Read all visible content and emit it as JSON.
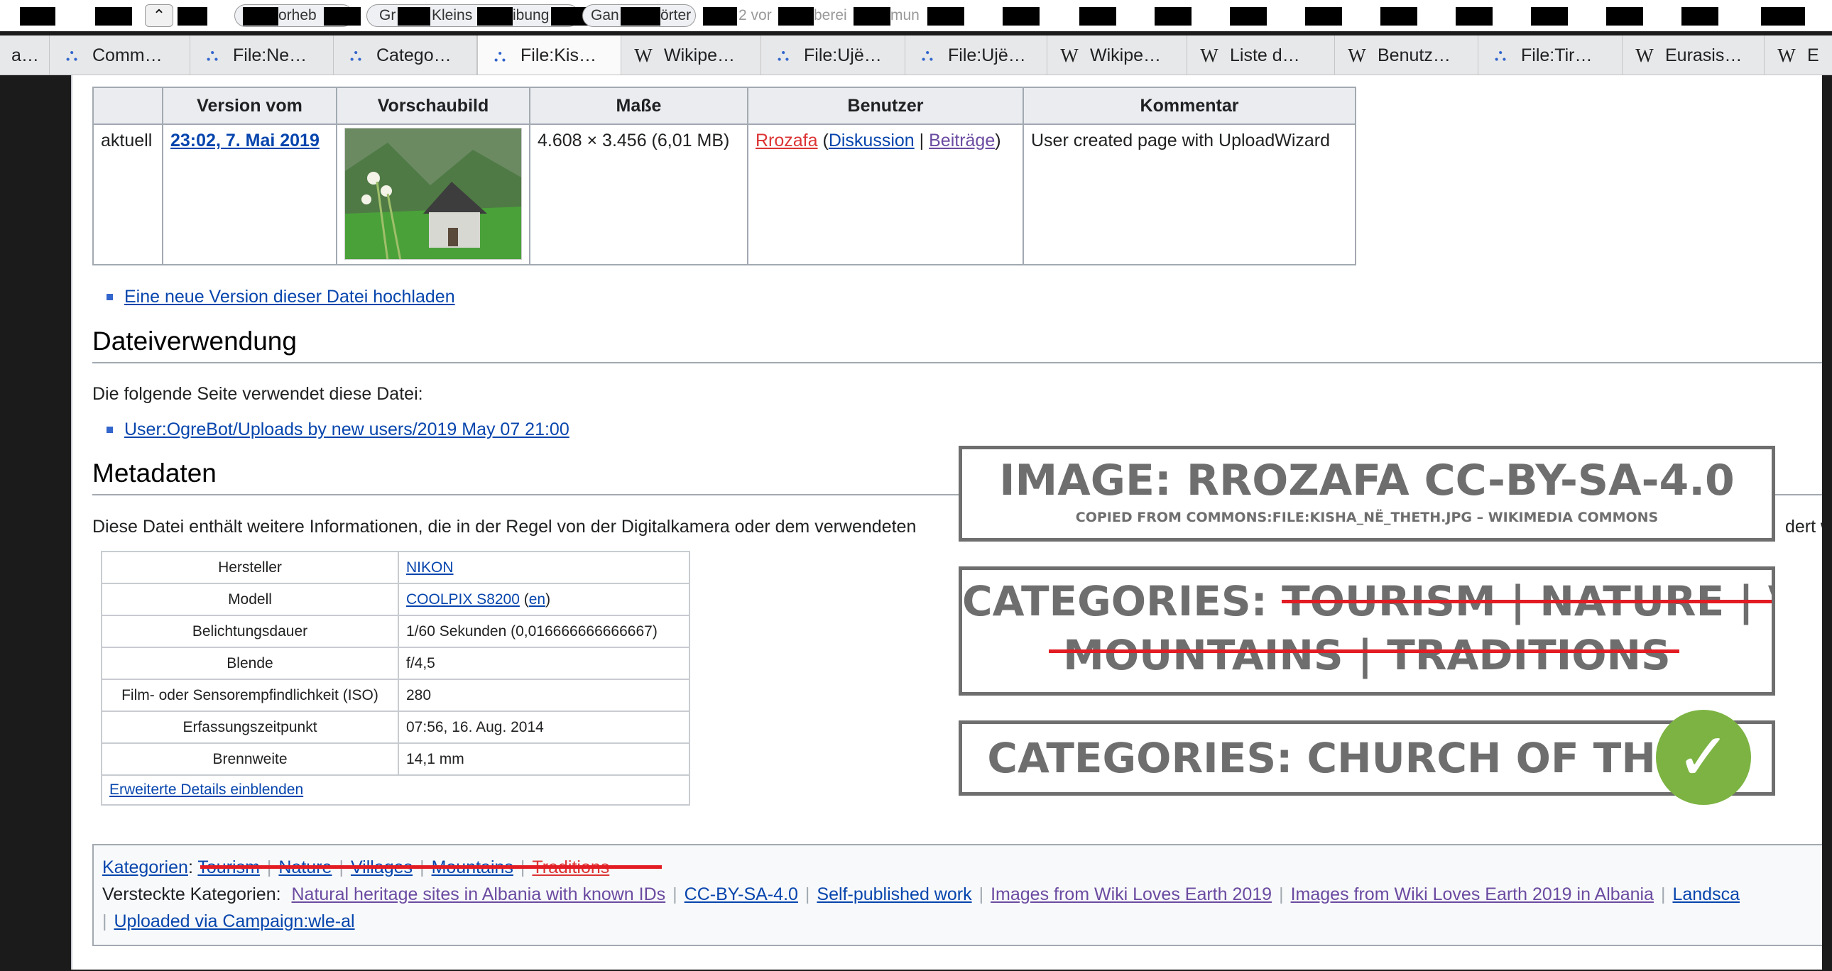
{
  "findbar": {
    "highlight": "orheb",
    "case": "Gr",
    "case2": "Kleins",
    "case3": "ibung",
    "words": "Gan",
    "words2": "örter",
    "matches": "2 vor",
    "matches2": "berei",
    "matches3": "mun"
  },
  "tabs": [
    {
      "icon": "commons",
      "label": "a…"
    },
    {
      "icon": "commons",
      "label": "Comm…"
    },
    {
      "icon": "commons",
      "label": "File:Ne…"
    },
    {
      "icon": "commons",
      "label": "Catego…"
    },
    {
      "icon": "commons",
      "label": "File:Kis…"
    },
    {
      "icon": "wikipedia",
      "label": "Wikipe…"
    },
    {
      "icon": "commons",
      "label": "File:Ujë…"
    },
    {
      "icon": "commons",
      "label": "File:Ujë…"
    },
    {
      "icon": "wikipedia",
      "label": "Wikipe…"
    },
    {
      "icon": "wikipedia",
      "label": "Liste d…"
    },
    {
      "icon": "wikipedia",
      "label": "Benutz…"
    },
    {
      "icon": "commons",
      "label": "File:Tir…"
    },
    {
      "icon": "wikipedia",
      "label": "Eurasis…"
    },
    {
      "icon": "wikipedia",
      "label": "E"
    }
  ],
  "history": {
    "headers": [
      "",
      "Version vom",
      "Vorschaubild",
      "Maße",
      "Benutzer",
      "Kommentar"
    ],
    "status": "aktuell",
    "date": "23:02, 7. Mai 2019",
    "dims": "4.608 × 3.456 (6,01 MB)",
    "user": "Rrozafa",
    "talk": "Diskussion",
    "sep": "|",
    "contribs": "Beiträge",
    "comment": "User created page with UploadWizard"
  },
  "upload_link": "Eine neue Version dieser Datei hochladen",
  "usage": {
    "heading": "Dateiverwendung",
    "intro": "Die folgende Seite verwendet diese Datei:",
    "link": "User:OgreBot/Uploads by new users/2019 May 07 21:00"
  },
  "metadata": {
    "heading": "Metadaten",
    "intro": "Diese Datei enthält weitere Informationen, die in der Regel von der Digitalkamera oder dem verwendeten",
    "intro_tail": "dert w",
    "rows": [
      {
        "key": "Hersteller",
        "value": "NIKON",
        "link": true
      },
      {
        "key": "Modell",
        "value": "COOLPIX S8200",
        "link": true,
        "extra": "en"
      },
      {
        "key": "Belichtungsdauer",
        "value": "1/60 Sekunden (0,016666666666667)"
      },
      {
        "key": "Blende",
        "value": "f/4,5"
      },
      {
        "key": "Film- oder Sensorempfindlichkeit (ISO)",
        "value": "280"
      },
      {
        "key": "Erfassungszeitpunkt",
        "value": "07:56, 16. Aug. 2014"
      },
      {
        "key": "Brennweite",
        "value": "14,1 mm"
      }
    ],
    "more": "Erweiterte Details einblenden"
  },
  "categories": {
    "label": "Kategorien",
    "items": [
      "Tourism",
      "Nature",
      "Villages",
      "Mountains",
      "Traditions"
    ],
    "hidden_label": "Versteckte Kategorien:",
    "hidden": [
      "Natural heritage sites in Albania with known IDs",
      "CC-BY-SA-4.0",
      "Self-published work",
      "Images from Wiki Loves Earth 2019",
      "Images from Wiki Loves Earth 2019 in Albania",
      "Landsca"
    ],
    "hidden2": "Uploaded via Campaign:wle-al"
  },
  "overlay": {
    "image_title": "IMAGE: RROZAFA CC-BY-SA-4.0",
    "image_sub": "COPIED FROM COMMONS:FILE:KISHA_NË_THETH.JPG – WIKIMEDIA COMMONS",
    "cat_prefix": "CATEGORIES: ",
    "cat_line1": "TOURISM | NATURE | VILLAGES |",
    "cat_line2": "MOUNTAINS | TRADITIONS",
    "cat_good": "CATEGORIES: CHURCH OF THETH",
    "check": "✓"
  },
  "colors": {
    "accent": "#0645ad",
    "strike": "#e31b23",
    "check": "#7cb342",
    "overlay_text": "#6e6e6e"
  }
}
